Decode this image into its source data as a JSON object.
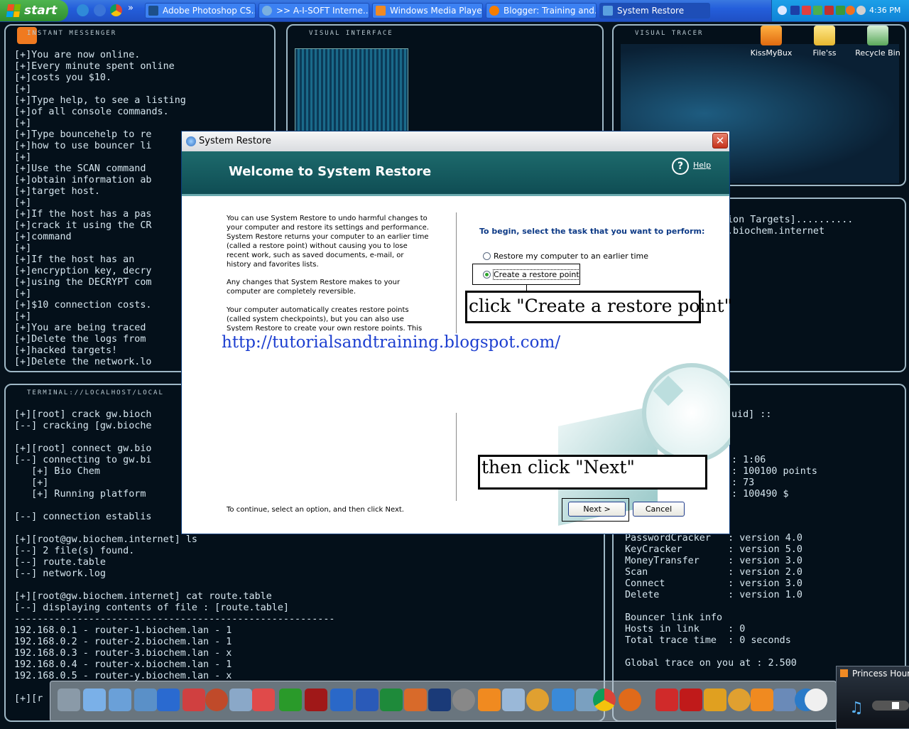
{
  "taskbar": {
    "start_label": "start",
    "tasks": [
      {
        "label": "Adobe Photoshop CS..."
      },
      {
        "label": ">> A-I-SOFT Interne..."
      },
      {
        "label": "Windows Media Player"
      },
      {
        "label": "Blogger: Training and..."
      },
      {
        "label": "System Restore"
      }
    ],
    "clock": "4:36 PM"
  },
  "desktop_icons": [
    {
      "label": "KissMyBux"
    },
    {
      "label": "File'ss"
    },
    {
      "label": "Recycle Bin"
    }
  ],
  "panels": {
    "messenger_title": "INSTANT MESSENGER",
    "visual_interface_title": "VISUAL INTERFACE",
    "visual_tracer_title": "VISUAL TRACER",
    "terminal_title": "TERMINAL://LOCALHOST/LOCAL",
    "messenger_text": "[+]You are now online.\n[+]Every minute spent online\n[+]costs you $10.\n[+]\n[+]Type help, to see a listing\n[+]of all console commands.\n[+]\n[+]Type bouncehelp to re\n[+]how to use bouncer li\n[+]\n[+]Use the SCAN command\n[+]obtain information ab\n[+]target host.\n[+]\n[+]If the host has a pas\n[+]crack it using the CR\n[+]command\n[+]\n[+]If the host has an\n[+]encryption key, decry\n[+]using the DECRYPT com\n[+]\n[+]$10 connection costs.\n[+]\n[+]You are being traced\n[+]Delete the logs from\n[+]hacked targets!\n[+]Delete the network.lo",
    "tracer_text": "ion Targets]..........\n.biochem.internet",
    "terminal_text": "[+][root] crack gw.bioch\n[--] cracking [gw.bioche\n\n[+][root] connect gw.bio\n[--] connecting to gw.bi\n   [+] Bio Chem\n   [+]\n   [+] Running platform\n\n[--] connection establis\n\n[+][root@gw.biochem.internet] ls\n[--] 2 file(s) found.\n[--] route.table\n[--] network.log\n\n[+][root@gw.biochem.internet] cat route.table\n[--] displaying contents of file : [route.table]\n--------------------------------------------------------\n192.168.0.1 - router-1.biochem.lan - 1\n192.168.0.2 - router-2.biochem.lan - 1\n192.168.0.3 - router-3.biochem.lan - x\n192.168.0.4 - router-x.biochem.lan - 1\n192.168.0.5 - router-y.biochem.lan - x\n\n[+][r",
    "stats_text": "uid] ::\n\n\n\n: 1:06\n: 100100 points\n: 73\n: 100490 $",
    "versions_text": "PasswordCracker   : version 4.0\nKeyCracker        : version 5.0\nMoneyTransfer     : version 3.0\nScan              : version 2.0\nConnect           : version 3.0\nDelete            : version 1.0\n\nBouncer link info\nHosts in link     : 0\nTotal trace time  : 0 seconds\n\nGlobal trace on you at : 2.500"
  },
  "dialog": {
    "title": "System Restore",
    "close_label": "✕",
    "heading": "Welcome to System Restore",
    "help_label": "Help",
    "paragraph1": "You can use System Restore to undo harmful changes to your computer and restore its settings and performance. System Restore returns your computer to an earlier time (called a restore point) without causing you to lose recent work, such as saved documents, e-mail, or history and favorites lists.",
    "paragraph2": "Any changes that System Restore makes to your computer are completely reversible.",
    "paragraph3": "Your computer automatically creates restore points (called system checkpoints), but you can also use System Restore to create your own restore points. This is useful if you are",
    "prompt": "To begin, select the task that you want to perform:",
    "option_restore": "Restore my computer to an earlier time",
    "option_create": "Create a restore point",
    "selected_option": "option_create",
    "continue_text": "To continue, select an option, and then click Next.",
    "next_label": "Next >",
    "cancel_label": "Cancel"
  },
  "annotations": {
    "callout1": "click \"Create a restore point\"",
    "url": "http://tutorialsandtraining.blogspot.com/",
    "callout2": "then click \"Next\""
  },
  "media_widget": {
    "title": "Princess Hour"
  },
  "colors": {
    "dialog_header": "#0f4d54",
    "taskbar": "#245edb",
    "start_button": "#3c9b3c",
    "link_blue": "#1d3fd0"
  }
}
